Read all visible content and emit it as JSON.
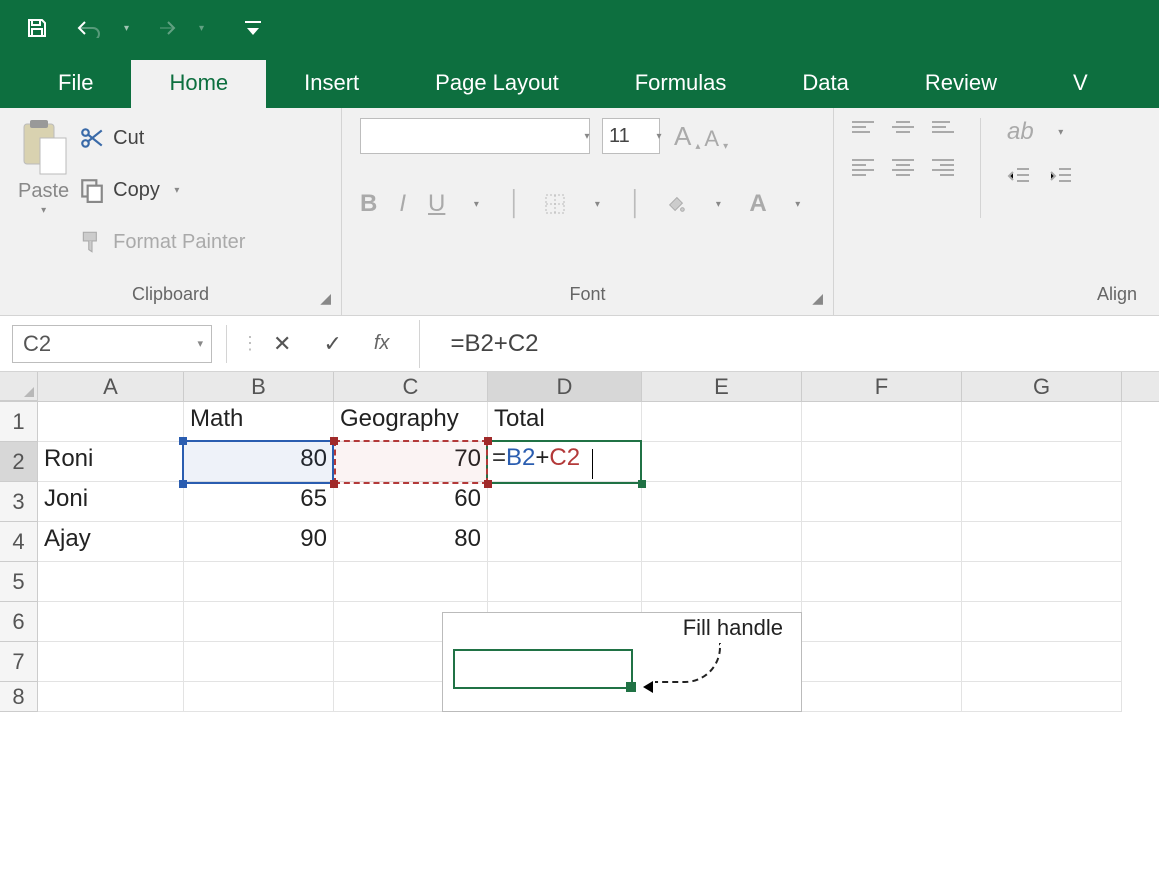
{
  "titleBar": {
    "save": "save",
    "undo": "undo",
    "redo": "redo",
    "customize": "customize"
  },
  "tabs": {
    "file": "File",
    "home": "Home",
    "insert": "Insert",
    "pageLayout": "Page Layout",
    "formulas": "Formulas",
    "data": "Data",
    "review": "Review",
    "view_partial": "V"
  },
  "ribbon": {
    "clipboard": {
      "groupLabel": "Clipboard",
      "paste": "Paste",
      "cut": "Cut",
      "copy": "Copy",
      "formatPainter": "Format Painter"
    },
    "font": {
      "groupLabel": "Font",
      "fontName": "",
      "fontSize": "11",
      "bold": "B",
      "italic": "I",
      "underline": "U",
      "increaseFont": "A",
      "decreaseFont": "A"
    },
    "alignment": {
      "groupLabel": "Align"
    }
  },
  "formulaBar": {
    "nameBox": "C2",
    "fx": "fx",
    "formula": "=B2+C2"
  },
  "grid": {
    "columns": [
      "A",
      "B",
      "C",
      "D",
      "E",
      "F",
      "G"
    ],
    "rows": [
      "1",
      "2",
      "3",
      "4",
      "5",
      "6",
      "7",
      "8"
    ],
    "headers": {
      "B1": "Math",
      "C1": "Geography",
      "D1": "Total"
    },
    "data": {
      "A2": "Roni",
      "B2": "80",
      "C2": "70",
      "A3": "Joni",
      "B3": "65",
      "C3": "60",
      "A4": "Ajay",
      "B4": "90",
      "C4": "80"
    },
    "editCell": {
      "ref": "D2",
      "b2": "B2",
      "plus": "+",
      "c2": "C2",
      "eq": "="
    }
  },
  "callout": {
    "label": "Fill handle"
  },
  "colors": {
    "excelGreen": "#0d6f3f",
    "selGreen": "#207245",
    "refBlue": "#2a5db0",
    "refRed": "#b33939"
  }
}
